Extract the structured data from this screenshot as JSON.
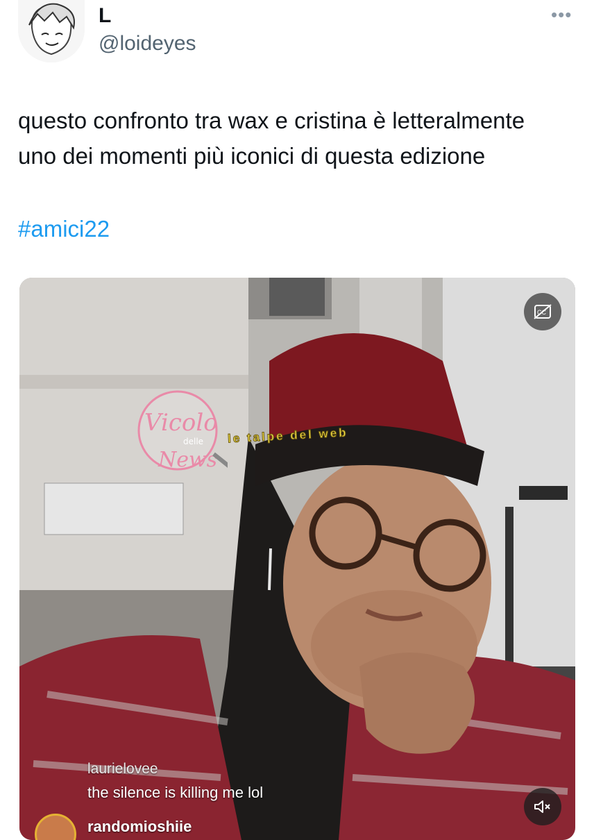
{
  "tweet": {
    "display_name": "L",
    "handle": "@loideyes",
    "more_icon": "more-horizontal-icon",
    "text": "questo confronto tra wax e cristina è letteralmente uno dei momenti più iconici di questa edizione",
    "hashtag": "#amici22"
  },
  "media": {
    "overlay_comments": [
      {
        "user": "laurielovee",
        "text": "the silence is killing me lol"
      },
      {
        "user": "randomioshiie",
        "text": ""
      }
    ],
    "watermarks": {
      "vicolo": [
        "Vicolo",
        "delle",
        "News"
      ],
      "talpe": "le talpe del web"
    },
    "cc_icon": "captions-off-icon",
    "mute_icon": "volume-muted-icon"
  },
  "colors": {
    "link": "#1d9bf0",
    "secondary_text": "#536471",
    "primary_text": "#0f1419"
  }
}
